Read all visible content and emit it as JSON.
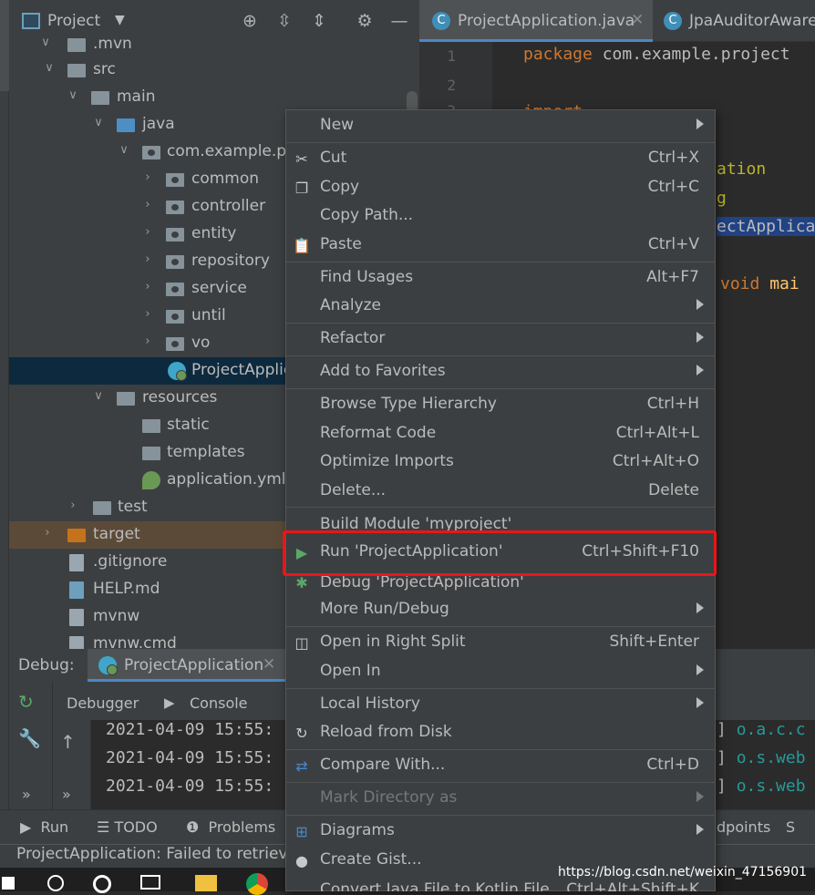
{
  "project_panel": {
    "title": "Project",
    "tree": [
      {
        "label": ".mvn"
      },
      {
        "label": "src"
      },
      {
        "label": "main"
      },
      {
        "label": "java"
      },
      {
        "label": "com.example.pro"
      },
      {
        "label": "common"
      },
      {
        "label": "controller"
      },
      {
        "label": "entity"
      },
      {
        "label": "repository"
      },
      {
        "label": "service"
      },
      {
        "label": "until"
      },
      {
        "label": "vo"
      },
      {
        "label": "ProjectApplic"
      },
      {
        "label": "resources"
      },
      {
        "label": "static"
      },
      {
        "label": "templates"
      },
      {
        "label": "application.yml"
      },
      {
        "label": "test"
      },
      {
        "label": "target"
      },
      {
        "label": ".gitignore"
      },
      {
        "label": "HELP.md"
      },
      {
        "label": "mvnw"
      },
      {
        "label": "mvnw.cmd"
      }
    ]
  },
  "editor": {
    "tabs": [
      {
        "label": "ProjectApplication.java",
        "close": "✕"
      },
      {
        "label": "JpaAuditorAware."
      }
    ],
    "line_numbers": [
      "1",
      "2",
      "3"
    ],
    "code": {
      "line1_kw": "package",
      "line1_rest": " com.example.project",
      "line3_kw": "import",
      "frag_ation": "ation",
      "frag_g": "g",
      "frag_app": "ectApplica",
      "frag_void": "void",
      "frag_main": " mai"
    }
  },
  "context_menu": {
    "items": [
      {
        "label": "New",
        "shortcut": ""
      },
      {
        "label": "Cut",
        "shortcut": "Ctrl+X"
      },
      {
        "label": "Copy",
        "shortcut": "Ctrl+C"
      },
      {
        "label": "Copy Path...",
        "shortcut": ""
      },
      {
        "label": "Paste",
        "shortcut": "Ctrl+V"
      },
      {
        "label": "Find Usages",
        "shortcut": "Alt+F7"
      },
      {
        "label": "Analyze",
        "shortcut": ""
      },
      {
        "label": "Refactor",
        "shortcut": ""
      },
      {
        "label": "Add to Favorites",
        "shortcut": ""
      },
      {
        "label": "Browse Type Hierarchy",
        "shortcut": "Ctrl+H"
      },
      {
        "label": "Reformat Code",
        "shortcut": "Ctrl+Alt+L"
      },
      {
        "label": "Optimize Imports",
        "shortcut": "Ctrl+Alt+O"
      },
      {
        "label": "Delete...",
        "shortcut": "Delete"
      },
      {
        "label": "Build Module 'myproject'",
        "shortcut": ""
      },
      {
        "label": "Run 'ProjectApplication'",
        "shortcut": "Ctrl+Shift+F10"
      },
      {
        "label": "Debug 'ProjectApplication'",
        "shortcut": ""
      },
      {
        "label": "More Run/Debug",
        "shortcut": ""
      },
      {
        "label": "Open in Right Split",
        "shortcut": "Shift+Enter"
      },
      {
        "label": "Open In",
        "shortcut": ""
      },
      {
        "label": "Local History",
        "shortcut": ""
      },
      {
        "label": "Reload from Disk",
        "shortcut": ""
      },
      {
        "label": "Compare With...",
        "shortcut": "Ctrl+D"
      },
      {
        "label": "Mark Directory as",
        "shortcut": ""
      },
      {
        "label": "Diagrams",
        "shortcut": ""
      },
      {
        "label": "Create Gist...",
        "shortcut": ""
      },
      {
        "label": "Convert Java File to Kotlin File",
        "shortcut": "Ctrl+Alt+Shift+K"
      }
    ]
  },
  "debug_panel": {
    "label": "Debug:",
    "tab": "ProjectApplication",
    "tab_close": "✕",
    "subtabs": [
      "Debugger",
      "Console"
    ],
    "log_lines": [
      "2021-04-09 15:55:",
      "2021-04-09 15:55:",
      "2021-04-09 15:55:"
    ],
    "log_right": [
      {
        "bracket": "]",
        "pkg": "o.a.c.c"
      },
      {
        "bracket": "]",
        "pkg": "o.s.web"
      },
      {
        "bracket": "]",
        "pkg": "o.s.web"
      }
    ],
    "chevrons": "»"
  },
  "bottom_tools": {
    "run": "Run",
    "todo": "TODO",
    "problems": "Problems",
    "breakpoints_fragment": "dpoints",
    "s_fragment": "S"
  },
  "status_bar": {
    "text": "ProjectApplication: Failed to retrieve a"
  },
  "watermark": "https://blog.csdn.net/weixin_47156901"
}
